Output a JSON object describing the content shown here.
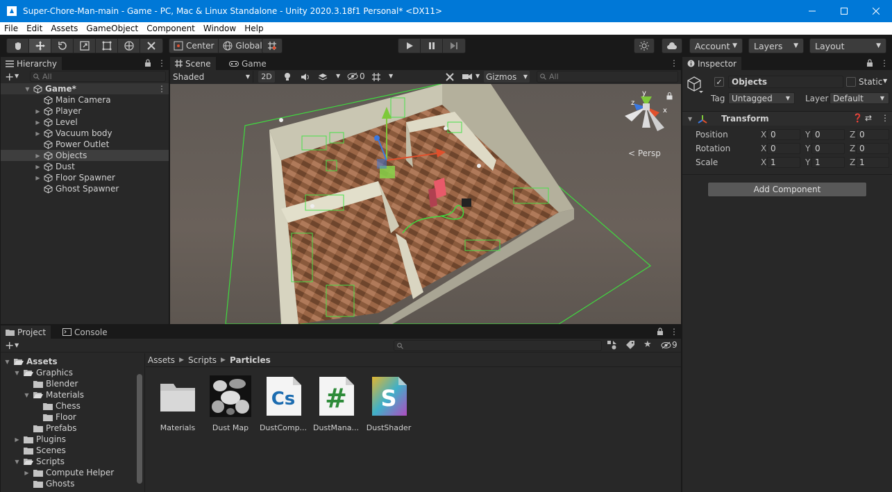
{
  "window": {
    "title": "Super-Chore-Man-main - Game - PC, Mac & Linux Standalone - Unity 2020.3.18f1 Personal* <DX11>"
  },
  "menu": [
    "File",
    "Edit",
    "Assets",
    "GameObject",
    "Component",
    "Window",
    "Help"
  ],
  "toolbar": {
    "pivot_label": "Center",
    "space_label": "Global",
    "account_label": "Account",
    "layers_label": "Layers",
    "layout_label": "Layout"
  },
  "hierarchy": {
    "tab_label": "Hierarchy",
    "search_placeholder": "All",
    "scene_name": "Game*",
    "items": [
      {
        "label": "Main Camera",
        "expandable": false
      },
      {
        "label": "Player",
        "expandable": true
      },
      {
        "label": "Level",
        "expandable": true
      },
      {
        "label": "Vacuum body",
        "expandable": true
      },
      {
        "label": "Power Outlet",
        "expandable": false
      },
      {
        "label": "Objects",
        "expandable": true,
        "selected": true
      },
      {
        "label": "Dust",
        "expandable": true
      },
      {
        "label": "Floor Spawner",
        "expandable": true
      },
      {
        "label": "Ghost Spawner",
        "expandable": false
      }
    ]
  },
  "scene": {
    "tab_scene": "Scene",
    "tab_game": "Game",
    "shading_mode": "Shaded",
    "mode_2d": "2D",
    "hidden_count": "0",
    "gizmos_label": "Gizmos",
    "search_placeholder": "All",
    "persp_label": "< Persp",
    "gizmo_axes": {
      "x": "x",
      "y": "y",
      "z": "z"
    }
  },
  "inspector": {
    "tab_label": "Inspector",
    "object_name": "Objects",
    "static_label": "Static",
    "tag_label": "Tag",
    "tag_value": "Untagged",
    "layer_label": "Layer",
    "layer_value": "Default",
    "transform_label": "Transform",
    "rows": [
      {
        "label": "Position",
        "x": "0",
        "y": "0",
        "z": "0"
      },
      {
        "label": "Rotation",
        "x": "0",
        "y": "0",
        "z": "0"
      },
      {
        "label": "Scale",
        "x": "1",
        "y": "1",
        "z": "1"
      }
    ],
    "axis_x": "X",
    "axis_y": "Y",
    "axis_z": "Z",
    "add_component_label": "Add Component"
  },
  "project": {
    "tab_project": "Project",
    "tab_console": "Console",
    "hidden_count": "9",
    "breadcrumb": [
      "Assets",
      "Scripts",
      "Particles"
    ],
    "tree": [
      {
        "label": "Assets",
        "depth": 0,
        "expanded": true,
        "bold": true
      },
      {
        "label": "Graphics",
        "depth": 1,
        "expanded": true
      },
      {
        "label": "Blender",
        "depth": 2,
        "expanded": null
      },
      {
        "label": "Materials",
        "depth": 2,
        "expanded": true
      },
      {
        "label": "Chess",
        "depth": 3,
        "expanded": null
      },
      {
        "label": "Floor",
        "depth": 3,
        "expanded": null
      },
      {
        "label": "Prefabs",
        "depth": 2,
        "expanded": null
      },
      {
        "label": "Plugins",
        "depth": 1,
        "expanded": false
      },
      {
        "label": "Scenes",
        "depth": 1,
        "expanded": null
      },
      {
        "label": "Scripts",
        "depth": 1,
        "expanded": true
      },
      {
        "label": "Compute Helper",
        "depth": 2,
        "expanded": false
      },
      {
        "label": "Ghosts",
        "depth": 2,
        "expanded": null
      }
    ],
    "assets": [
      {
        "label": "Materials",
        "kind": "folder-icon"
      },
      {
        "label": "Dust Map",
        "kind": "texture-icon"
      },
      {
        "label": "DustComp...",
        "kind": "cs-script-icon"
      },
      {
        "label": "DustMana...",
        "kind": "hash-script-icon"
      },
      {
        "label": "DustShader",
        "kind": "shader-icon"
      }
    ],
    "icon_text": {
      "cs": "Cs",
      "hash": "#",
      "shader": "S"
    }
  }
}
